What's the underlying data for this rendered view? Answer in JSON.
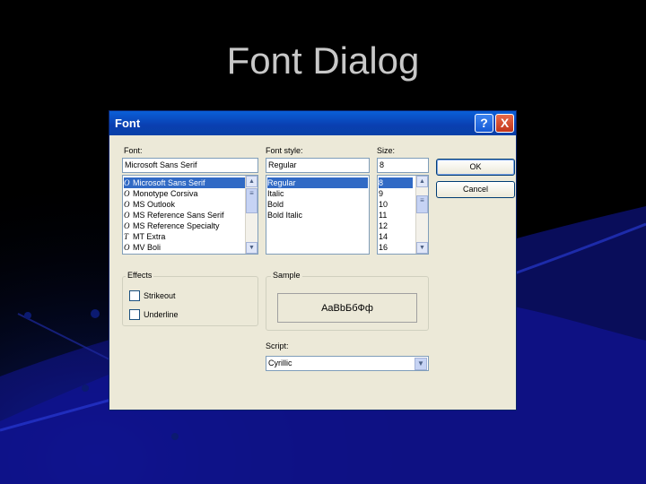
{
  "slide": {
    "title": "Font Dialog"
  },
  "dialog": {
    "title": "Font",
    "help_label": "?",
    "close_label": "X",
    "font": {
      "label": "Font:",
      "value": "Microsoft Sans Serif",
      "items": [
        {
          "icon": "O",
          "label": "Microsoft Sans Serif",
          "selected": true
        },
        {
          "icon": "O",
          "label": "Monotype Corsiva"
        },
        {
          "icon": "O",
          "label": "MS Outlook"
        },
        {
          "icon": "O",
          "label": "MS Reference Sans Serif"
        },
        {
          "icon": "O",
          "label": "MS Reference Specialty"
        },
        {
          "icon": "T",
          "label": "MT Extra"
        },
        {
          "icon": "O",
          "label": "MV Boli"
        }
      ]
    },
    "style": {
      "label": "Font style:",
      "value": "Regular",
      "items": [
        "Regular",
        "Italic",
        "Bold",
        "Bold Italic"
      ]
    },
    "size": {
      "label": "Size:",
      "value": "8",
      "items": [
        "8",
        "9",
        "10",
        "11",
        "12",
        "14",
        "16"
      ]
    },
    "buttons": {
      "ok": "OK",
      "cancel": "Cancel"
    },
    "effects": {
      "label": "Effects",
      "strikeout": "Strikeout",
      "underline": "Underline"
    },
    "sample": {
      "label": "Sample",
      "text": "AaBbБбФф"
    },
    "script": {
      "label": "Script:",
      "value": "Cyrillic"
    }
  }
}
